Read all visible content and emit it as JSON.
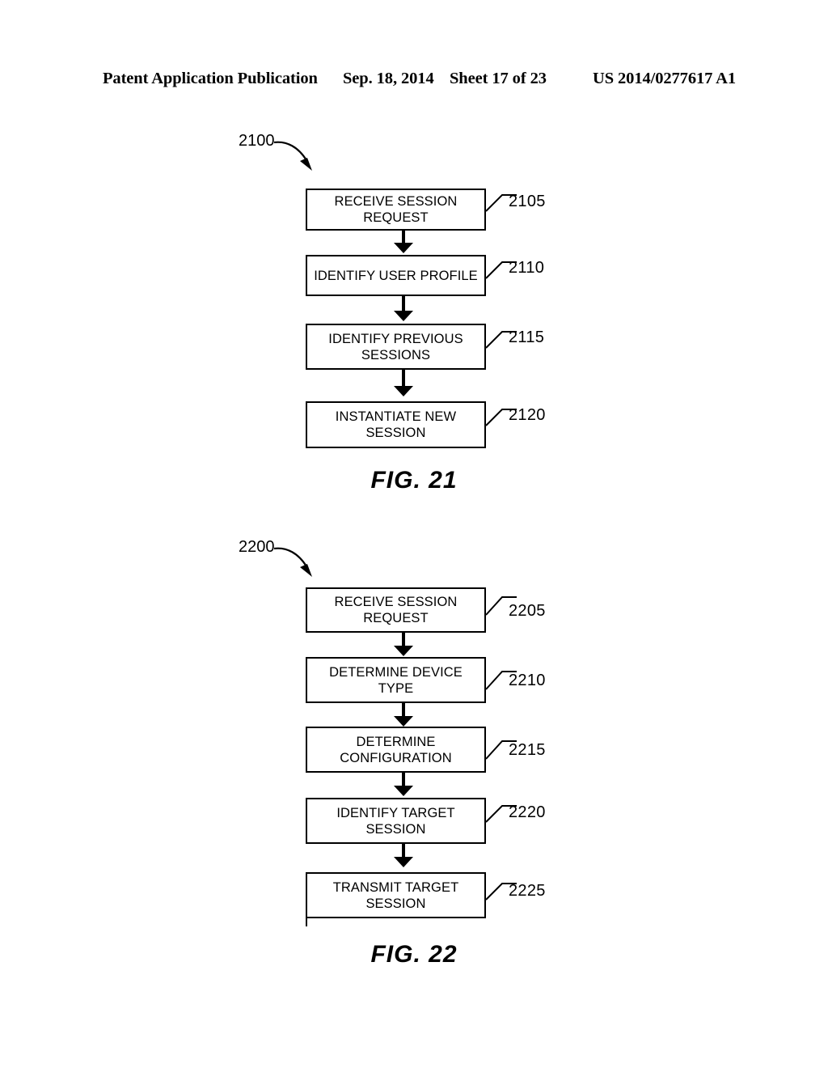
{
  "header": {
    "publication": "Patent Application Publication",
    "date": "Sep. 18, 2014",
    "sheet": "Sheet 17 of 23",
    "patent_number": "US 2014/0277617 A1"
  },
  "figures": [
    {
      "id": "fig-21",
      "caption": "FIG. 21",
      "diagram_ref": "2100",
      "steps": [
        {
          "label": "RECEIVE SESSION REQUEST",
          "lines": [
            "RECEIVE SESSION",
            "REQUEST"
          ],
          "ref": "2105"
        },
        {
          "label": "IDENTIFY USER PROFILE",
          "lines": [
            "IDENTIFY USER PROFILE"
          ],
          "ref": "2110"
        },
        {
          "label": "IDENTIFY PREVIOUS SESSIONS",
          "lines": [
            "IDENTIFY PREVIOUS",
            "SESSIONS"
          ],
          "ref": "2115"
        },
        {
          "label": "INSTANTIATE NEW SESSION",
          "lines": [
            "INSTANTIATE NEW",
            "SESSION"
          ],
          "ref": "2120"
        }
      ]
    },
    {
      "id": "fig-22",
      "caption": "FIG. 22",
      "diagram_ref": "2200",
      "steps": [
        {
          "label": "RECEIVE SESSION REQUEST",
          "lines": [
            "RECEIVE SESSION",
            "REQUEST"
          ],
          "ref": "2205"
        },
        {
          "label": "DETERMINE DEVICE TYPE",
          "lines": [
            "DETERMINE DEVICE",
            "TYPE"
          ],
          "ref": "2210"
        },
        {
          "label": "DETERMINE CONFIGURATION",
          "lines": [
            "DETERMINE",
            "CONFIGURATION"
          ],
          "ref": "2215"
        },
        {
          "label": "IDENTIFY TARGET SESSION",
          "lines": [
            "IDENTIFY TARGET",
            "SESSION"
          ],
          "ref": "2220"
        },
        {
          "label": "TRANSMIT TARGET SESSION",
          "lines": [
            "TRANSMIT TARGET",
            "SESSION"
          ],
          "ref": "2225"
        }
      ]
    }
  ],
  "colors": {
    "ink": "#000000",
    "paper": "#ffffff"
  }
}
